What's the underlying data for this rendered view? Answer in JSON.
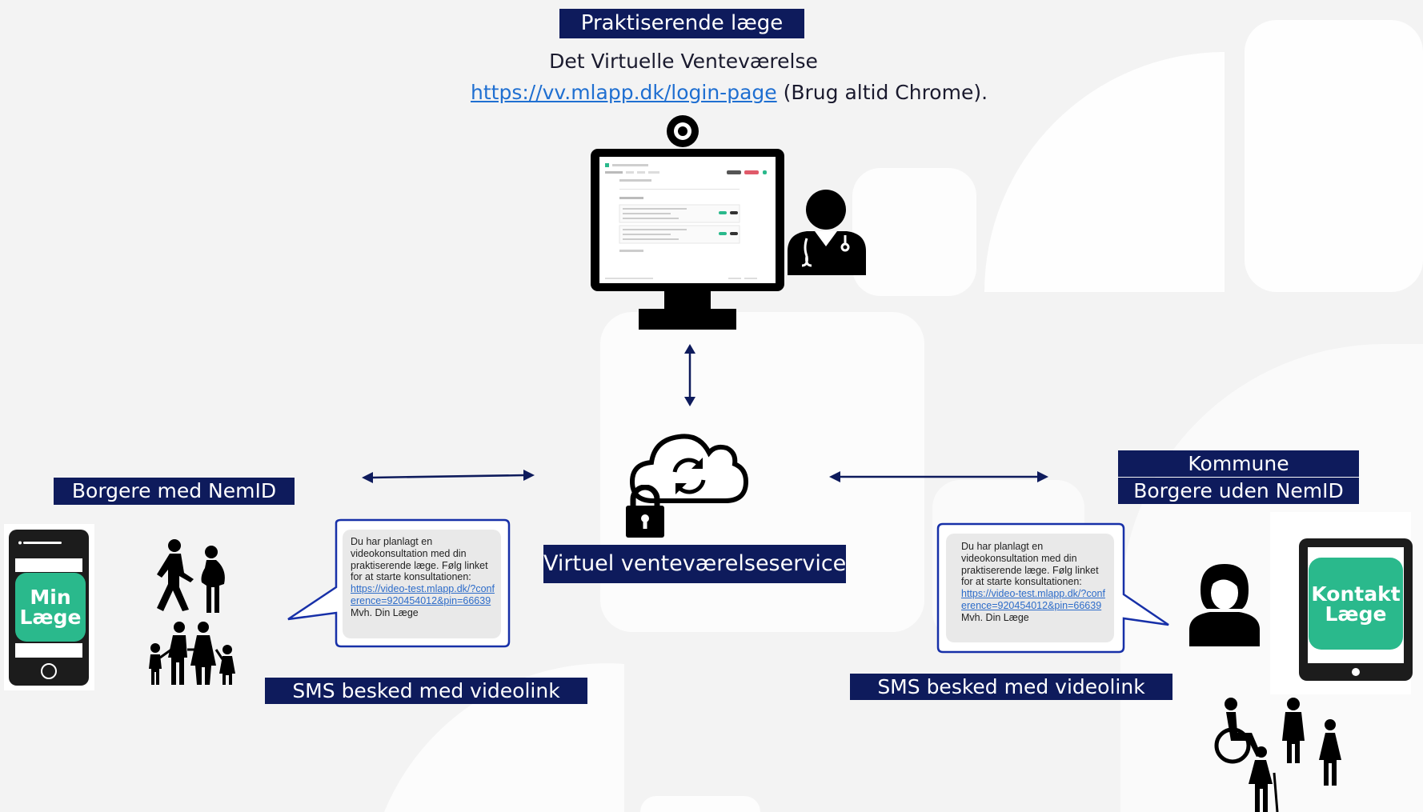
{
  "top": {
    "gp_label": "Praktiserende læge",
    "waiting_room_title": "Det Virtuelle Venteværelse",
    "login_url": "https://vv.mlapp.dk/login-page",
    "chrome_note": "(Brug altid Chrome)."
  },
  "center": {
    "service_label": "Virtuel venteværelseservice"
  },
  "left": {
    "group_label": "Borgere med NemID",
    "app_name_line1": "Min",
    "app_name_line2": "Læge",
    "sms_label": "SMS besked med videolink",
    "sms": {
      "text": "Du har planlagt en videokonsultation med din praktiserende læge. Følg linket for at starte konsultationen:",
      "link": "https://video-test.mlapp.dk/?conference=920454012&pin=66639",
      "signoff": "Mvh. Din Læge"
    }
  },
  "right": {
    "group_label_line1": "Kommune",
    "group_label_line2": "Borgere uden NemID",
    "app_name_line1": "Kontakt",
    "app_name_line2": "Læge",
    "sms_label": "SMS besked med videolink",
    "sms": {
      "text": "Du har planlagt en videokonsultation med din praktiserende læge. Følg linket for at starte konsultationen:",
      "link": "https://video-test.mlapp.dk/?conference=920454012&pin=66639",
      "signoff": "Mvh. Din Læge"
    }
  },
  "colors": {
    "navy": "#0e1b5c",
    "app_green": "#2ab98c",
    "link_blue": "#1f6fd1",
    "background": "#f3f3f3"
  },
  "icons": [
    "webcam-icon",
    "monitor-icon",
    "doctor-icon",
    "cloud-sync-icon",
    "padlock-icon",
    "smartphone-icon",
    "tablet-icon",
    "family-icon",
    "woman-icon",
    "elderly-group-icon"
  ]
}
